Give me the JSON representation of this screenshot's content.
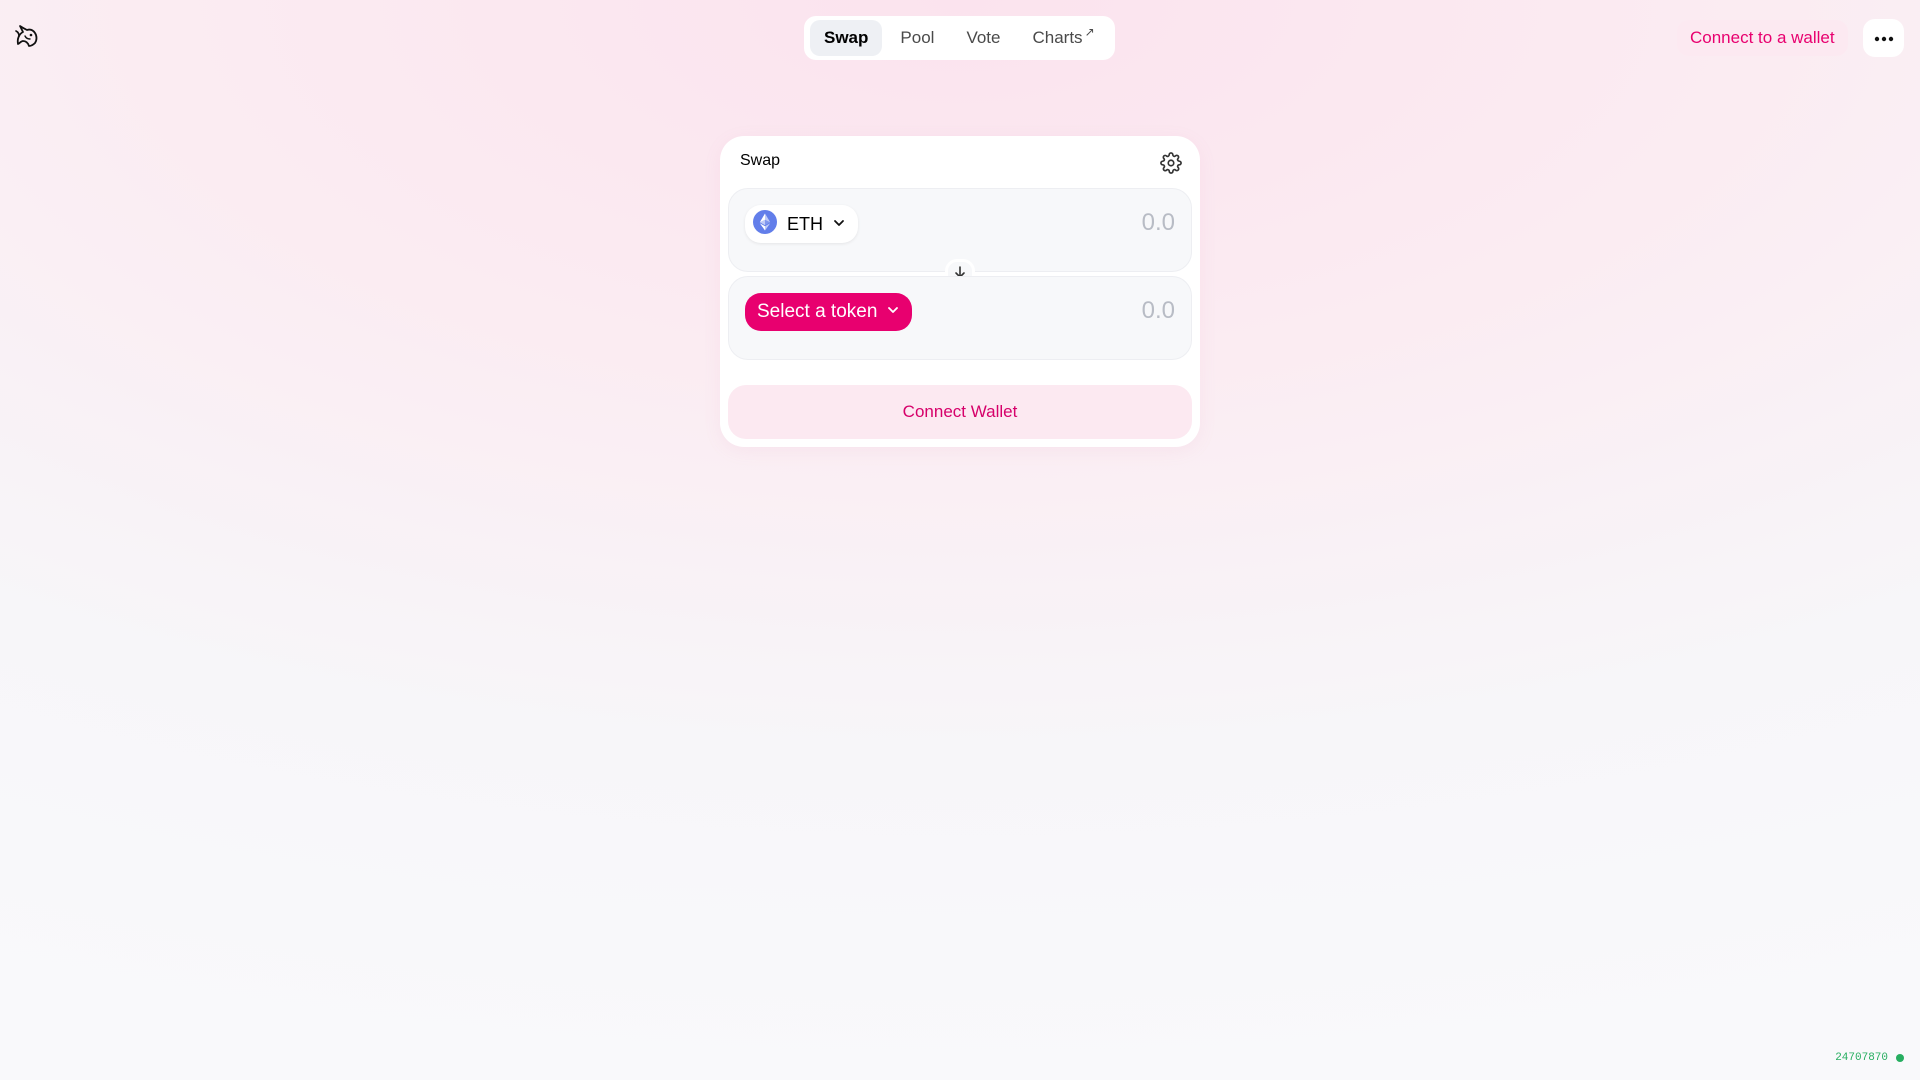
{
  "header": {
    "logo_icon": "unicorn-icon",
    "nav": [
      {
        "label": "Swap",
        "active": true
      },
      {
        "label": "Pool",
        "active": false
      },
      {
        "label": "Vote",
        "active": false
      },
      {
        "label": "Charts",
        "active": false,
        "external": "↗"
      }
    ],
    "connect_label": "Connect to a wallet",
    "more_icon": "more-horizontal-icon"
  },
  "swap": {
    "title": "Swap",
    "settings_icon": "gear-icon",
    "input": {
      "token_symbol": "ETH",
      "token_icon": "ethereum-icon",
      "amount_placeholder": "0.0",
      "amount_value": ""
    },
    "switch_icon": "arrow-down-icon",
    "output": {
      "select_label": "Select a token",
      "amount_placeholder": "0.0",
      "amount_value": ""
    },
    "connect_wallet_label": "Connect Wallet"
  },
  "footer": {
    "block_number": "24707870",
    "status_color": "#27ae60"
  },
  "colors": {
    "accent": "#e8006f",
    "accent_soft": "#fce9f1"
  }
}
